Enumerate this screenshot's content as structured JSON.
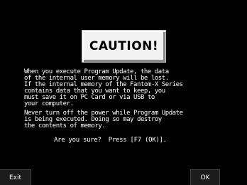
{
  "dialog": {
    "title": "CAUTION!",
    "paragraph1": "When you execute Program Update, the data\nof the internal user memory will be lost.\nIf the internal memory of the Fantom-X Series\ncontains data that you want to keep, you\nmust save it on PC Card or via USB to\nyour computer.",
    "paragraph2": "Never turn off the power while Program Update\nis being executed. Doing so may destroy\nthe contents of memory.",
    "prompt": "Are you sure?  Press [F7 (OK)]."
  },
  "buttons": {
    "exit_label": "Exit",
    "ok_label": "OK"
  },
  "colors": {
    "background": "#000000",
    "text": "#ffffff",
    "caution_box": "#f2f2f2"
  }
}
